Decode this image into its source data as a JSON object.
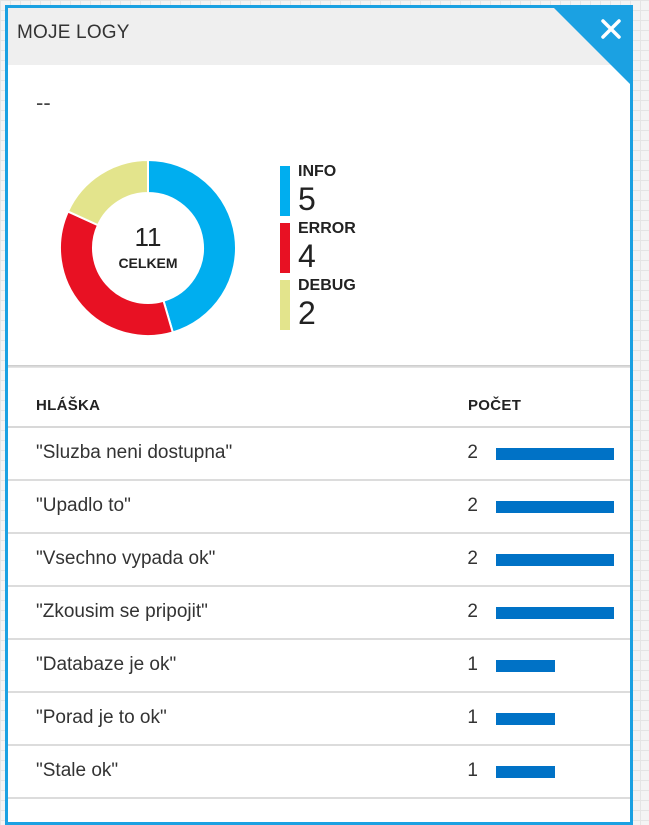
{
  "panel": {
    "title": "MOJE LOGY",
    "subtitle": "--"
  },
  "colors": {
    "accent": "#1ba1e2",
    "bar": "#0072c6",
    "info": "#00aeef",
    "error": "#e81123",
    "debug": "#e3e48c"
  },
  "icons": {
    "close": "close-icon"
  },
  "chart_data": {
    "type": "pie",
    "total": "11",
    "total_label": "CELKEM",
    "categories": [
      "INFO",
      "ERROR",
      "DEBUG"
    ],
    "values": [
      5,
      4,
      2
    ],
    "colors": [
      "#00aeef",
      "#e81123",
      "#e3e48c"
    ]
  },
  "legend": [
    {
      "name": "INFO",
      "count": "5"
    },
    {
      "name": "ERROR",
      "count": "4"
    },
    {
      "name": "DEBUG",
      "count": "2"
    }
  ],
  "table": {
    "headers": {
      "message": "HLÁŠKA",
      "count": "POČET"
    },
    "max_count": 2,
    "rows": [
      {
        "message": "\"Sluzba neni dostupna\"",
        "count": 2
      },
      {
        "message": "\"Upadlo to\"",
        "count": 2
      },
      {
        "message": "\"Vsechno vypada ok\"",
        "count": 2
      },
      {
        "message": "\"Zkousim se pripojit\"",
        "count": 2
      },
      {
        "message": "\"Databaze je ok\"",
        "count": 1
      },
      {
        "message": "\"Porad je to ok\"",
        "count": 1
      },
      {
        "message": "\"Stale ok\"",
        "count": 1
      }
    ]
  }
}
